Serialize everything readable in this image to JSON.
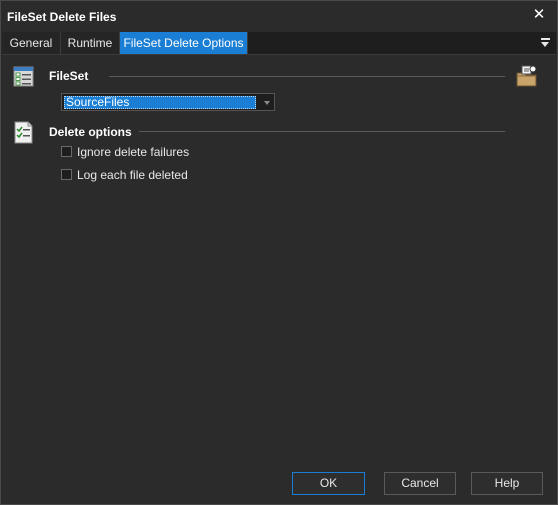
{
  "window": {
    "title": "FileSet Delete Files",
    "close_glyph": "✕"
  },
  "tabs": [
    {
      "label": "General",
      "active": false
    },
    {
      "label": "Runtime",
      "active": false
    },
    {
      "label": "FileSet Delete Options",
      "active": true
    }
  ],
  "tab_menu_icon": "dropdown-menu-icon",
  "fileset_section": {
    "title": "FileSet",
    "icon": "fileset-checklist-icon",
    "selected_value": "SourceFiles",
    "action_icon": "folder-options-icon"
  },
  "delete_section": {
    "title": "Delete options",
    "icon": "document-checklist-icon",
    "options": [
      {
        "label": "Ignore delete failures",
        "checked": false
      },
      {
        "label": "Log each file deleted",
        "checked": false
      }
    ]
  },
  "buttons": {
    "ok": "OK",
    "cancel": "Cancel",
    "help": "Help"
  },
  "colors": {
    "background": "#2b2b2b",
    "accent": "#1a7fd4",
    "text": "#e8e8e8"
  }
}
